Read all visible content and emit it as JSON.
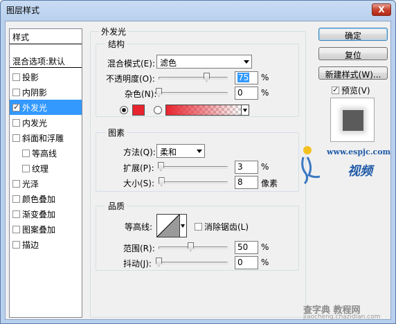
{
  "window": {
    "title": "图层样式",
    "close": "X"
  },
  "stylelist": {
    "header": "样式",
    "blend_options": "混合选项:默认",
    "items": [
      {
        "label": "投影",
        "checked": false,
        "indent": false,
        "selected": false
      },
      {
        "label": "内阴影",
        "checked": false,
        "indent": false,
        "selected": false
      },
      {
        "label": "外发光",
        "checked": true,
        "indent": false,
        "selected": true
      },
      {
        "label": "内发光",
        "checked": false,
        "indent": false,
        "selected": false
      },
      {
        "label": "斜面和浮雕",
        "checked": false,
        "indent": false,
        "selected": false
      },
      {
        "label": "等高线",
        "checked": false,
        "indent": true,
        "selected": false
      },
      {
        "label": "纹理",
        "checked": false,
        "indent": true,
        "selected": false
      },
      {
        "label": "光泽",
        "checked": false,
        "indent": false,
        "selected": false
      },
      {
        "label": "颜色叠加",
        "checked": false,
        "indent": false,
        "selected": false
      },
      {
        "label": "渐变叠加",
        "checked": false,
        "indent": false,
        "selected": false
      },
      {
        "label": "图案叠加",
        "checked": false,
        "indent": false,
        "selected": false
      },
      {
        "label": "描边",
        "checked": false,
        "indent": false,
        "selected": false
      }
    ]
  },
  "panel": {
    "title": "外发光"
  },
  "structure": {
    "title": "结构",
    "blend_mode_label": "混合模式(E):",
    "blend_mode_value": "滤色",
    "opacity_label": "不透明度(O):",
    "opacity_value": "75",
    "opacity_unit": "%",
    "noise_label": "杂色(N):",
    "noise_value": "0",
    "noise_unit": "%",
    "glow_color": "#e8242f",
    "opacity_level": 0.75,
    "noise_level": 0.0
  },
  "elements": {
    "title": "图素",
    "technique_label": "方法(Q):",
    "technique_value": "柔和",
    "spread_label": "扩展(P):",
    "spread_value": "3",
    "spread_unit": "%",
    "spread_level": 0.03,
    "size_label": "大小(S):",
    "size_value": "8",
    "size_unit": "像素",
    "size_level": 0.04
  },
  "quality": {
    "title": "品质",
    "contour_label": "等高线:",
    "antialias_label": "消除锯齿(L)",
    "antialias_checked": false,
    "range_label": "范围(R):",
    "range_value": "50",
    "range_unit": "%",
    "range_level": 0.5,
    "jitter_label": "抖动(J):",
    "jitter_value": "0",
    "jitter_unit": "%",
    "jitter_level": 0.0
  },
  "buttons": {
    "ok": "确定",
    "reset": "复位",
    "new_style": "新建样式(W)...",
    "preview_label": "预览(V)",
    "preview_checked": true
  },
  "watermark": {
    "site": "www.espjc.com",
    "brand": "视频",
    "bottom": "查字典 教程网",
    "bottom_url": "jiaocheng.chazidian.com"
  }
}
